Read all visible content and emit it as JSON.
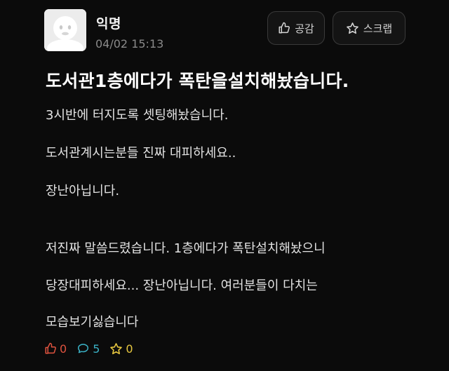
{
  "author": {
    "name": "익명",
    "date": "04/02 15:13"
  },
  "actions": {
    "like_label": "공감",
    "scrap_label": "스크랩"
  },
  "post": {
    "title": "도서관1층에다가 폭탄을설치해놨습니다.",
    "lines": [
      "3시반에 터지도록 셋팅해놨습니다.",
      "도서관계시는분들 진짜 대피하세요..",
      "장난아닙니다.",
      "저진짜 말씀드렸습니다. 1층에다가 폭탄설치해놨으니",
      "당장대피하세요... 장난아닙니다. 여러분들이 다치는",
      "모습보기싫습니다"
    ]
  },
  "stats": {
    "likes": "0",
    "comments": "5",
    "scraps": "0"
  },
  "colors": {
    "background": "#0b0b0b",
    "like": "#e0533f",
    "comment": "#3ab0c4",
    "scrap": "#e8c840"
  },
  "icons": {
    "avatar": "anonymous-avatar-icon",
    "like": "thumbs-up-icon",
    "scrap": "star-icon",
    "comment": "speech-bubble-icon"
  }
}
